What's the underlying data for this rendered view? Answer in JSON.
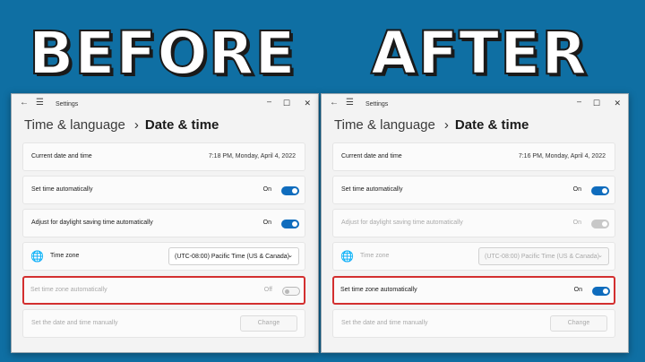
{
  "titles": {
    "before": "BEFORE",
    "after": "AFTER"
  },
  "app_name": "Settings",
  "breadcrumb": {
    "parent": "Time & language",
    "separator": "›",
    "current": "Date & time"
  },
  "before": {
    "current_date_label": "Current date and time",
    "current_date_value": "7:18 PM, Monday, April 4, 2022",
    "set_time_auto_label": "Set time automatically",
    "set_time_auto_state": "On",
    "dst_label": "Adjust for daylight saving time automatically",
    "dst_state": "On",
    "timezone_label": "Time zone",
    "timezone_value": "(UTC-08:00) Pacific Time (US & Canada)",
    "tz_auto_label": "Set time zone automatically",
    "tz_auto_state": "Off",
    "manual_label": "Set the date and time manually",
    "change_label": "Change"
  },
  "after": {
    "current_date_label": "Current date and time",
    "current_date_value": "7:16 PM, Monday, April 4, 2022",
    "set_time_auto_label": "Set time automatically",
    "set_time_auto_state": "On",
    "dst_label": "Adjust for daylight saving time automatically",
    "dst_state": "On",
    "timezone_label": "Time zone",
    "timezone_value": "(UTC-08:00) Pacific Time (US & Canada)",
    "tz_auto_label": "Set time zone automatically",
    "tz_auto_state": "On",
    "manual_label": "Set the date and time manually",
    "change_label": "Change"
  },
  "icons": {
    "back": "back-arrow-icon",
    "menu": "hamburger-menu-icon",
    "minimize": "minimize-icon",
    "maximize": "maximize-icon",
    "close": "close-icon",
    "timezone": "globe-clock-icon",
    "dropdown": "chevron-down-icon"
  },
  "colors": {
    "background": "#0f6fa3",
    "accent": "#0f6cbd",
    "highlight": "#d32f2f",
    "window": "#f3f3f3",
    "disabled_text": "#a9a9a9"
  }
}
